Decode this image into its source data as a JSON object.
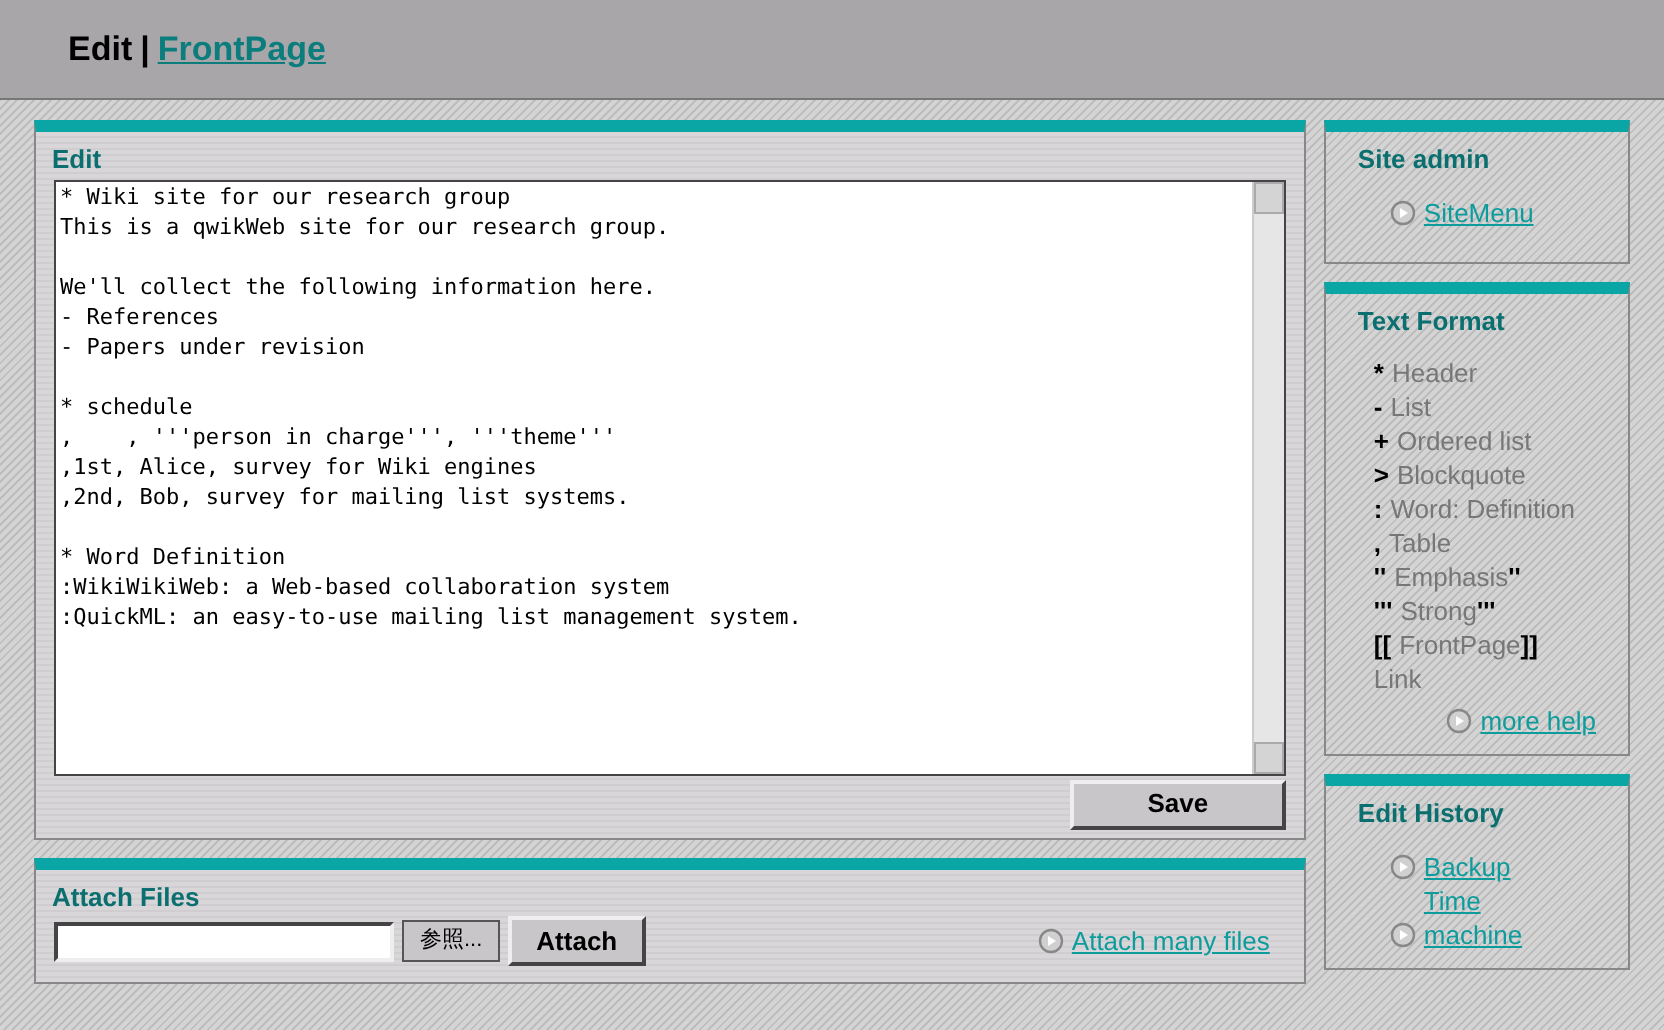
{
  "header": {
    "mode": "Edit",
    "separator": "|",
    "page_link": "FrontPage"
  },
  "edit": {
    "title": "Edit",
    "content": "* Wiki site for our research group\nThis is a qwikWeb site for our research group.\n\nWe'll collect the following information here.\n- References\n- Papers under revision\n\n* schedule\n,    , '''person in charge''', '''theme'''\n,1st, Alice, survey for Wiki engines\n,2nd, Bob, survey for mailing list systems.\n\n* Word Definition\n:WikiWikiWeb: a Web-based collaboration system\n:QuickML: an easy-to-use mailing list management system.",
    "save_button": "Save"
  },
  "attach": {
    "title": "Attach Files",
    "browse_button": "参照...",
    "attach_button": "Attach",
    "many_link": "Attach many files"
  },
  "site_admin": {
    "title": "Site admin",
    "links": [
      "SiteMenu"
    ]
  },
  "text_format": {
    "title": "Text Format",
    "items": [
      {
        "marker": "*",
        "label": "Header"
      },
      {
        "marker": "-",
        "label": "List"
      },
      {
        "marker": "+",
        "label": "Ordered list"
      },
      {
        "marker": ">",
        "label": "Blockquote"
      },
      {
        "marker": ":",
        "label": "Word: Definition"
      },
      {
        "marker": ",",
        "label": "Table"
      },
      {
        "marker": "''",
        "label": "Emphasis",
        "marker_after": "''"
      },
      {
        "marker": "'''",
        "label": "Strong",
        "marker_after": "'''"
      },
      {
        "marker": "[[",
        "label": "FrontPage",
        "marker_after": "]]",
        "note": "Link"
      }
    ],
    "help_link": "more help"
  },
  "edit_history": {
    "title": "Edit History",
    "links": [
      "Backup Time",
      "machine"
    ]
  }
}
